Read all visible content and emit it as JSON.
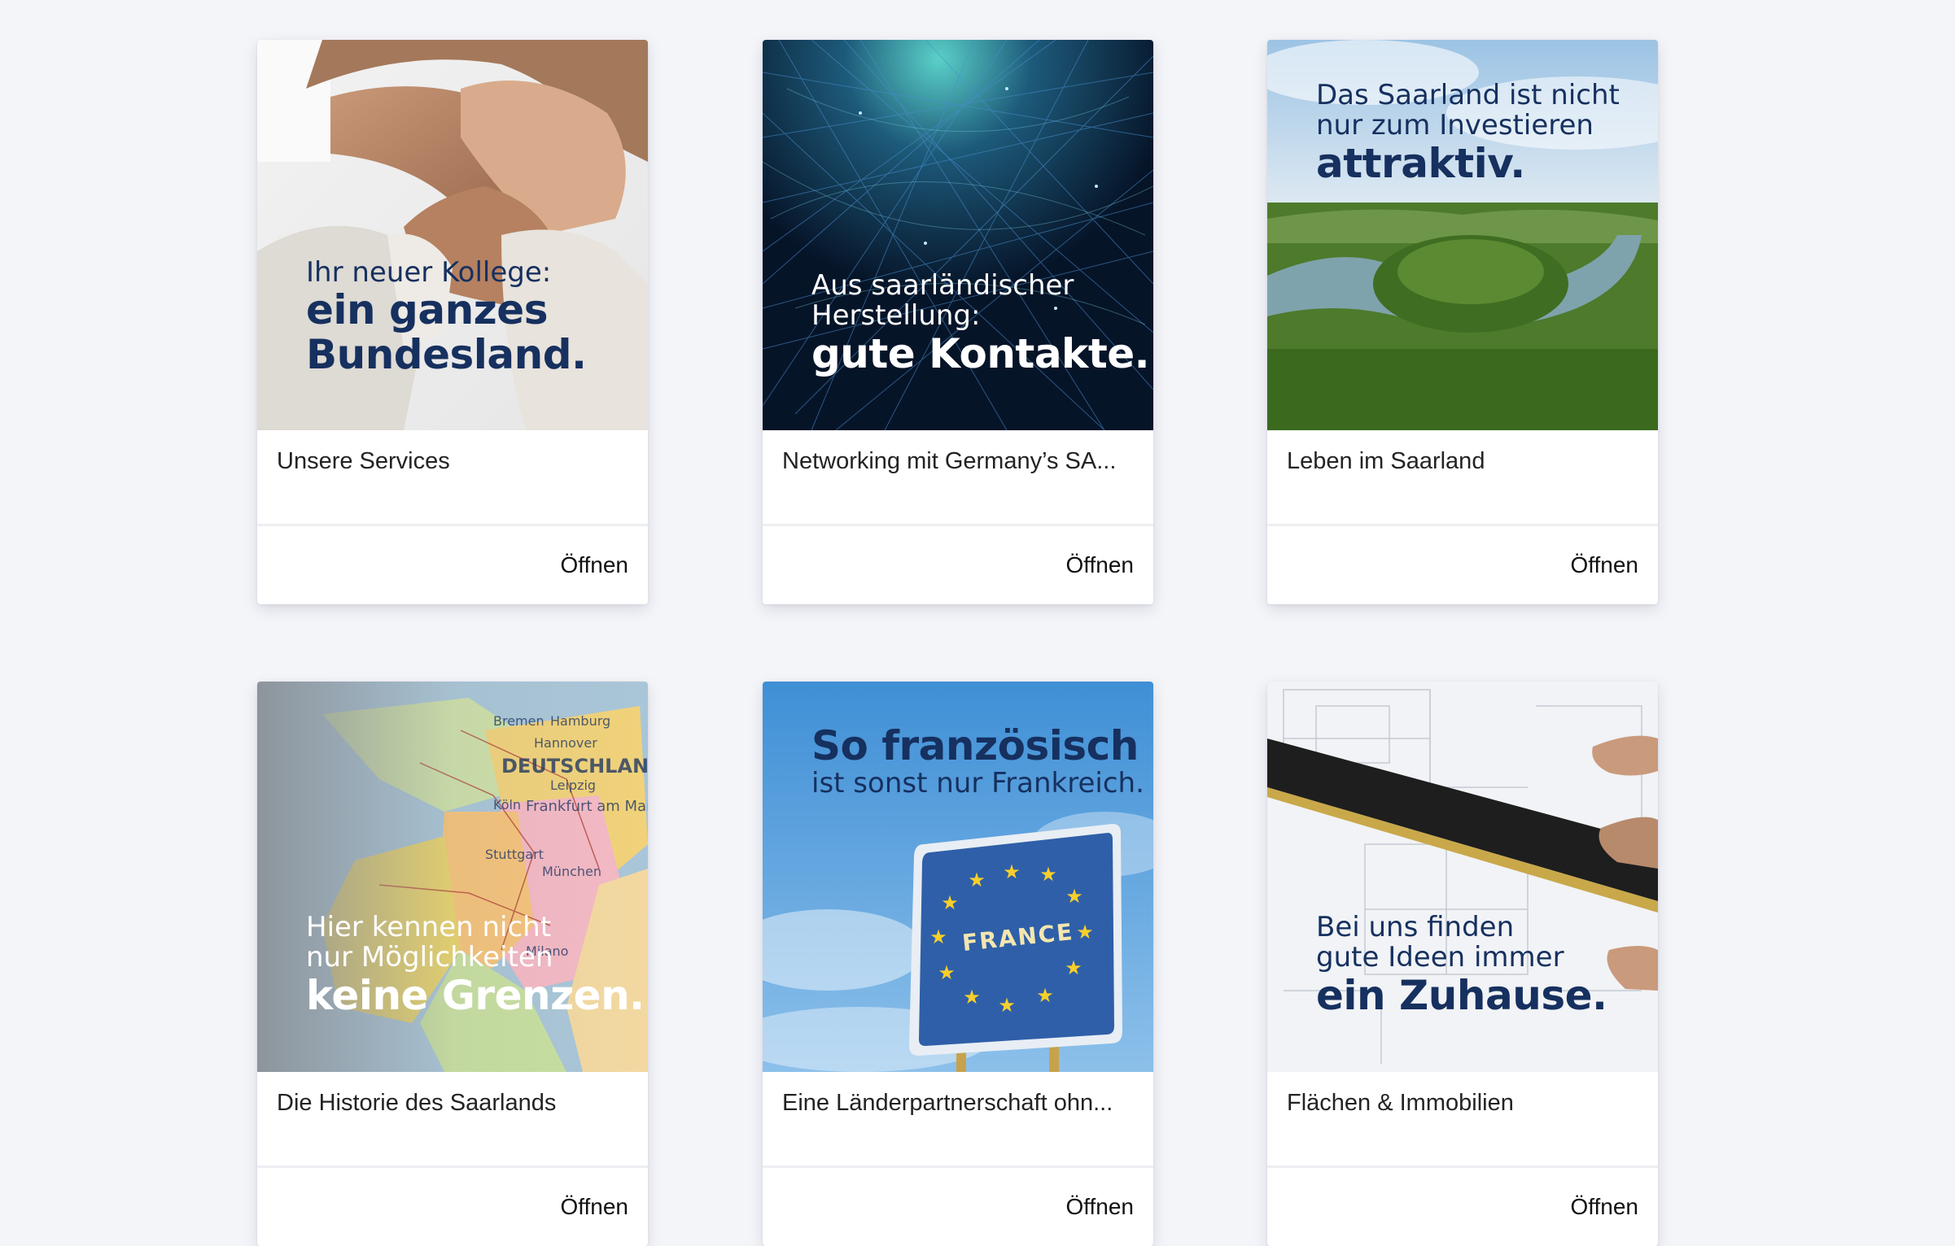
{
  "cards": [
    {
      "title": "Unsere Services",
      "open_label": "Öffnen",
      "overlay": {
        "line1": "Ihr neuer Kollege:",
        "line2": "",
        "bold1": "ein ganzes",
        "bold2": "Bundesland."
      }
    },
    {
      "title": "Networking mit Germany’s SA...",
      "open_label": "Öffnen",
      "overlay": {
        "line1": "Aus saarländischer",
        "line2": "Herstellung:",
        "bold1": "gute Kontakte.",
        "bold2": ""
      }
    },
    {
      "title": "Leben im Saarland",
      "open_label": "Öffnen",
      "overlay": {
        "line1": "Das Saarland ist nicht",
        "line2": "nur zum Investieren",
        "bold1": "attraktiv.",
        "bold2": ""
      }
    },
    {
      "title": "Die Historie des Saarlands",
      "open_label": "Öffnen",
      "overlay": {
        "line1": "Hier kennen nicht",
        "line2": "nur Möglichkeiten",
        "bold1": "keine Grenzen.",
        "bold2": ""
      },
      "map_labels": [
        "Bremen",
        "Hamburg",
        "Hannover",
        "DEUTSCHLAND",
        "Leipzig",
        "Köln",
        "Frankfurt am Main",
        "Stuttgart",
        "München",
        "Milano"
      ]
    },
    {
      "title": "Eine Länderpartnerschaft ohn...",
      "open_label": "Öffnen",
      "overlay": {
        "bold1": "So französisch",
        "line1": "ist sonst nur Frankreich."
      },
      "sign_text": "FRANCE"
    },
    {
      "title": "Flächen & Immobilien",
      "open_label": "Öffnen",
      "overlay": {
        "line1": "Bei uns finden",
        "line2": "gute Ideen immer",
        "bold1": "ein Zuhause.",
        "bold2": ""
      }
    }
  ],
  "colors": {
    "navy": "#16305f",
    "white": "#ffffff",
    "page_bg": "#f4f5f9"
  }
}
